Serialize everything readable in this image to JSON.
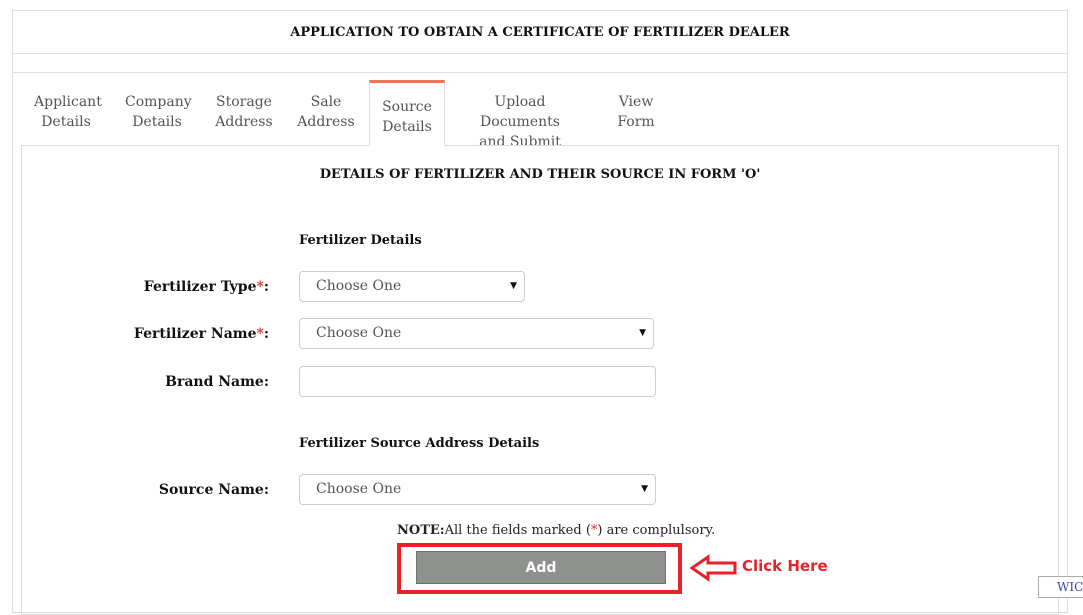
{
  "page": {
    "title": "APPLICATION TO OBTAIN A CERTIFICATE OF FERTILIZER DEALER"
  },
  "tabs": [
    {
      "line1": "Applicant",
      "line2": "Details"
    },
    {
      "line1": "Company",
      "line2": "Details"
    },
    {
      "line1": "Storage",
      "line2": "Address"
    },
    {
      "line1": "Sale",
      "line2": "Address"
    },
    {
      "line1": "Source",
      "line2": "Details"
    },
    {
      "line1": "Upload Documents",
      "line2": "and Submit"
    },
    {
      "line1": "View Form",
      "line2": ""
    }
  ],
  "active_tab": "Source Details",
  "form": {
    "heading": "DETAILS OF FERTILIZER AND THEIR SOURCE IN FORM 'O'",
    "fertilizer_section_title": "Fertilizer Details",
    "fertilizer_type": {
      "label": "Fertilizer Type",
      "required_mark": "*",
      "colon": ":",
      "value": "Choose One"
    },
    "fertilizer_name": {
      "label": "Fertilizer Name",
      "required_mark": "*",
      "colon": ":",
      "value": "Choose One"
    },
    "brand_name": {
      "label": "Brand Name:",
      "value": ""
    },
    "source_section_title": "Fertilizer Source Address Details",
    "source_name": {
      "label": "Source Name:",
      "value": "Choose One"
    },
    "note": {
      "prefix": "NOTE:",
      "text_before": "All the fields marked (",
      "mark": "*",
      "text_after": ") are complulsory."
    },
    "add_button": "Add"
  },
  "annotation": {
    "text": "Click Here",
    "color": "#e8222a"
  },
  "corner_tag": "WIC",
  "colors": {
    "active_tab_accent": "#f0735a",
    "button_bg": "#8e918d",
    "required": "#d9322d"
  },
  "icons": {
    "dropdown": "triangle-down",
    "annotation_arrow": "arrow-left-outline"
  }
}
